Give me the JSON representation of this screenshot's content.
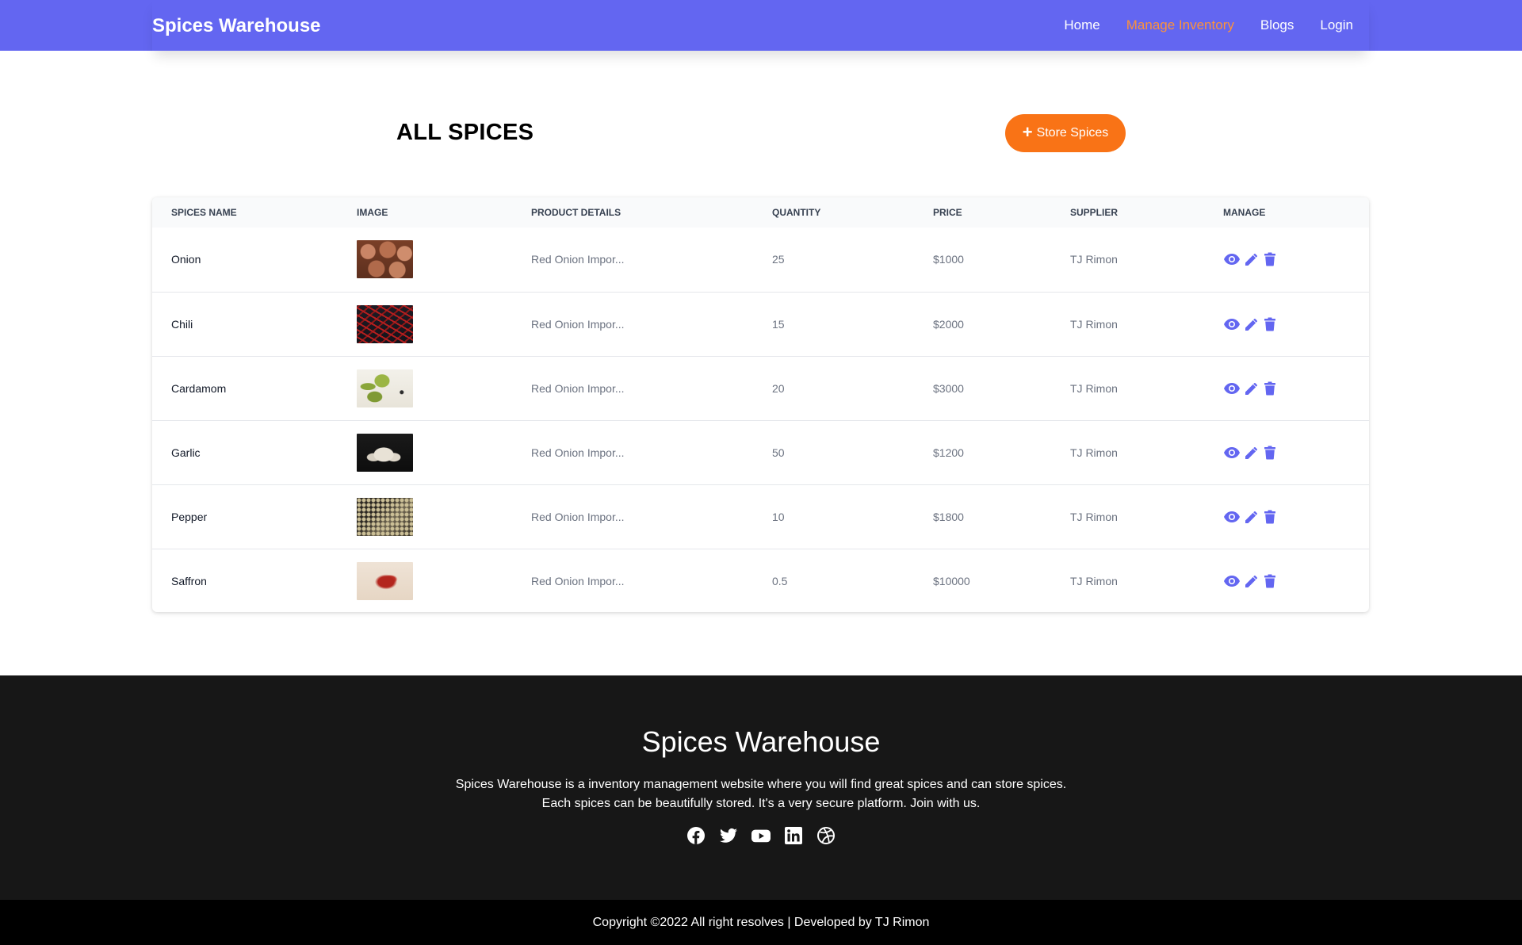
{
  "navbar": {
    "brand": "Spices Warehouse",
    "links": [
      {
        "label": "Home"
      },
      {
        "label": "Manage Inventory",
        "active": true
      },
      {
        "label": "Blogs"
      },
      {
        "label": "Login"
      }
    ]
  },
  "header": {
    "title": "ALL SPICES",
    "store_button_label": "Store Spices"
  },
  "table": {
    "columns": [
      "SPICES NAME",
      "IMAGE",
      "PRODUCT DETAILS",
      "QUANTITY",
      "PRICE",
      "SUPPLIER",
      "MANAGE"
    ],
    "rows": [
      {
        "name": "Onion",
        "details": "Red Onion Impor...",
        "quantity": "25",
        "price": "$1000",
        "supplier": "TJ Rimon",
        "image": "onion"
      },
      {
        "name": "Chili",
        "details": "Red Onion Impor...",
        "quantity": "15",
        "price": "$2000",
        "supplier": "TJ Rimon",
        "image": "chili"
      },
      {
        "name": "Cardamom",
        "details": "Red Onion Impor...",
        "quantity": "20",
        "price": "$3000",
        "supplier": "TJ Rimon",
        "image": "cardamom"
      },
      {
        "name": "Garlic",
        "details": "Red Onion Impor...",
        "quantity": "50",
        "price": "$1200",
        "supplier": "TJ Rimon",
        "image": "garlic"
      },
      {
        "name": "Pepper",
        "details": "Red Onion Impor...",
        "quantity": "10",
        "price": "$1800",
        "supplier": "TJ Rimon",
        "image": "pepper"
      },
      {
        "name": "Saffron",
        "details": "Red Onion Impor...",
        "quantity": "0.5",
        "price": "$10000",
        "supplier": "TJ Rimon",
        "image": "saffron"
      }
    ],
    "manage_icons": [
      "eye-icon",
      "pencil-icon",
      "trash-icon"
    ]
  },
  "footer": {
    "title": "Spices Warehouse",
    "description_line1": "Spices Warehouse is a inventory management website where you will find great spices and can store spices.",
    "description_line2": "Each spices can be beautifully stored. It's a very secure platform. Join with us.",
    "socials": [
      "facebook-icon",
      "twitter-icon",
      "youtube-icon",
      "linkedin-icon",
      "dribbble-icon"
    ],
    "copyright": "Copyright ©2022 All right resolves | Developed by TJ Rimon"
  },
  "colors": {
    "nav_bg": "#6366f1",
    "nav_active": "#fb923c",
    "accent_orange": "#f97316",
    "icon_purple": "#6366f1",
    "footer_bg": "#171717",
    "copyright_bg": "#000000"
  }
}
